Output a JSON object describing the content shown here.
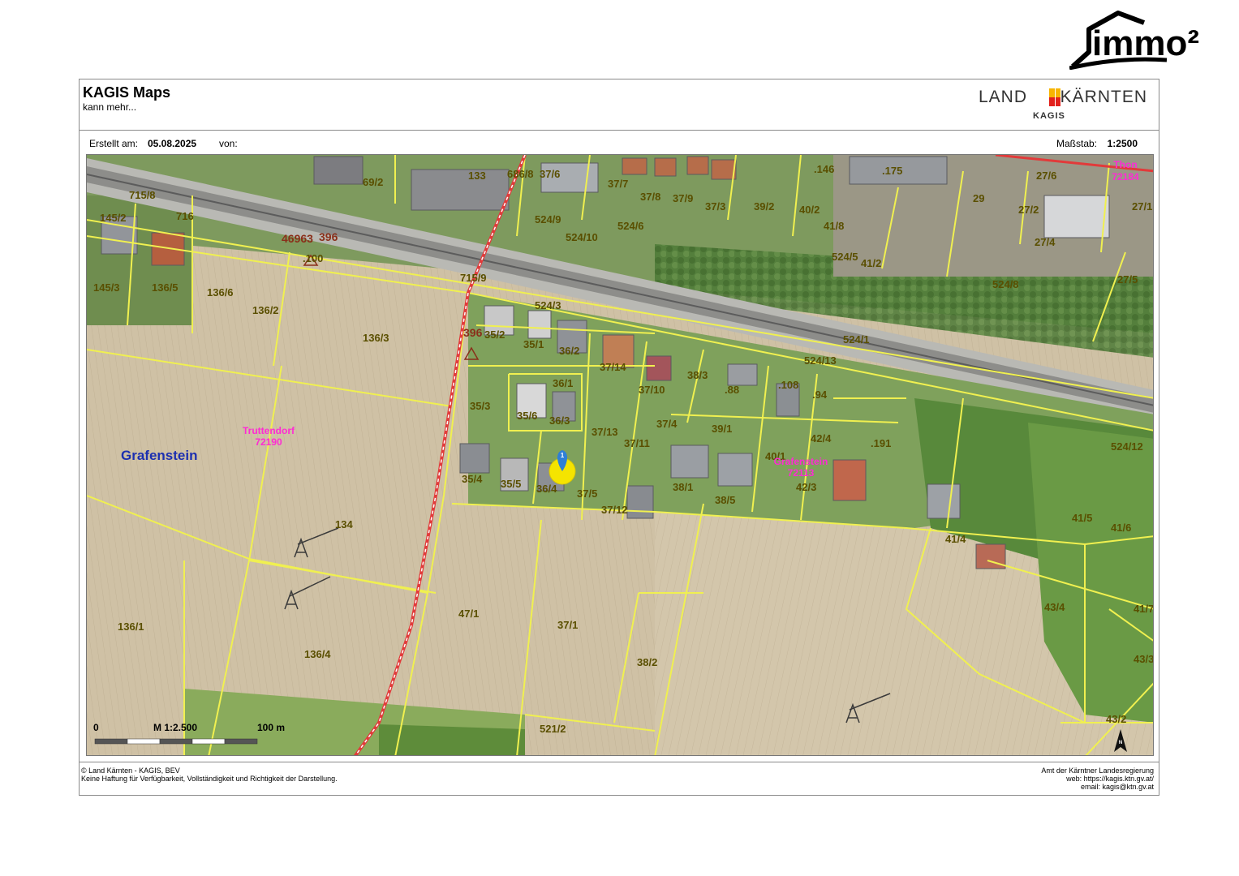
{
  "brand": {
    "logo_text": "immo²"
  },
  "header": {
    "title": "KAGIS Maps",
    "subtitle": "kann mehr...",
    "land_left": "LAND",
    "land_right": "KÄRNTEN",
    "land_sub": "KAGIS"
  },
  "meta": {
    "created_label": "Erstellt am:",
    "created_value": "05.08.2025",
    "by_label": "von:",
    "scale_label": "Maßstab:",
    "scale_value": "1:2500"
  },
  "map": {
    "municipality": "Grafenstein",
    "towns": [
      {
        "name": "Truttendorf",
        "code": "72190"
      },
      {
        "name": "Grafenstein",
        "code": "72113"
      },
      {
        "name": "Thon",
        "code": "72184"
      }
    ],
    "elevation_labels": [
      "46963",
      "396",
      ".100",
      "396"
    ],
    "marker_label": "1",
    "parcels": [
      "715/8",
      "145/2",
      "716",
      "145/3",
      "136/5",
      "136/6",
      "136/2",
      "136/3",
      "69/2",
      "133",
      "686/8",
      "37/6",
      "524/9",
      "524/10",
      "37/7",
      "37/8",
      "37/9",
      "37/3",
      "39/2",
      "40/2",
      ".146",
      ".175",
      "29",
      "27/6",
      "27/2",
      "27/1",
      "27/4",
      "41/8",
      "524/6",
      "524/5",
      "41/2",
      "524/8",
      "27/5",
      "715/9",
      "524/3",
      "35/2",
      "35/1",
      "36/2",
      "37/14",
      "37/10",
      "38/3",
      ".88",
      ".108",
      ".94",
      "524/1",
      "524/13",
      "36/1",
      "35/3",
      "35/6",
      "36/3",
      "37/13",
      "37/4",
      "39/1",
      "40/1",
      "42/4",
      ".191",
      "37/11",
      "35/4",
      "35/5",
      "36/4",
      "37/5",
      "37/12",
      "38/1",
      "38/5",
      "42/3",
      "524/12",
      "41/5",
      "41/4",
      "41/6",
      "134",
      "136/1",
      "136/4",
      "47/1",
      "37/1",
      "38/2",
      "43/4",
      "41/7",
      "43/3",
      "43/2",
      "521/2"
    ],
    "scale_bar": {
      "start": "0",
      "mid": "M 1:2.500",
      "end": "100 m"
    },
    "north_label": "N"
  },
  "footer": {
    "left_line1": "© Land Kärnten - KAGIS, BEV",
    "left_line2": "Keine Haftung für Verfügbarkeit, Vollständigkeit und Richtigkeit der Darstellung.",
    "right_line1": "Amt der Kärntner Landesregierung",
    "right_line2": "web: https://kagis.ktn.gv.at/",
    "right_line3": "email: kagis@ktn.gv.at"
  }
}
